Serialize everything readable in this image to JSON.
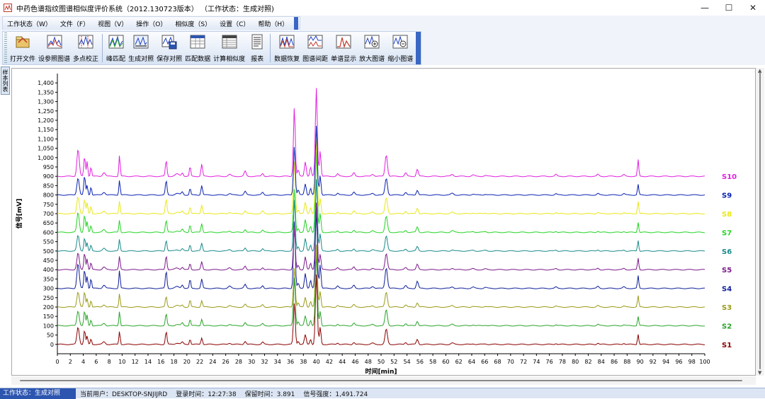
{
  "window": {
    "title": "中药色谱指纹图谱相似度评价系统（2012.130723版本） （工作状态：生成对照)",
    "controls": {
      "minimize": "—",
      "maximize": "☐",
      "close": "✕"
    }
  },
  "menu": [
    {
      "label": "工作状态（W）"
    },
    {
      "label": "文件（F）"
    },
    {
      "label": "视图（V）"
    },
    {
      "label": "操作（O）"
    },
    {
      "label": "相似度（S）"
    },
    {
      "label": "设置（C）"
    },
    {
      "label": "帮助（H）"
    }
  ],
  "toolbar": {
    "group1": [
      {
        "label": "打开文件",
        "icon": "open-file-icon"
      },
      {
        "label": "设参照图谱",
        "icon": "set-reference-icon"
      },
      {
        "label": "多点校正",
        "icon": "multipoint-correction-icon"
      }
    ],
    "group2": [
      {
        "label": "峰匹配",
        "icon": "peak-match-icon"
      },
      {
        "label": "生成对照",
        "icon": "generate-control-icon"
      },
      {
        "label": "保存对照",
        "icon": "save-control-icon"
      },
      {
        "label": "匹配数据",
        "icon": "match-data-icon"
      },
      {
        "label": "计算相似度",
        "icon": "calculate-similarity-icon"
      },
      {
        "label": "报表",
        "icon": "report-icon"
      }
    ],
    "group3": [
      {
        "label": "数据恢复",
        "icon": "data-restore-icon"
      },
      {
        "label": "图谱间距",
        "icon": "spectrum-spacing-icon"
      },
      {
        "label": "单谱显示",
        "icon": "single-spectrum-icon"
      },
      {
        "label": "放大图谱",
        "icon": "zoom-in-icon"
      },
      {
        "label": "缩小图谱",
        "icon": "zoom-out-icon"
      }
    ]
  },
  "dock_tab": {
    "label": "样本列表"
  },
  "chart_data": {
    "type": "line",
    "xlabel": "时间[min]",
    "ylabel": "信号[mV]",
    "xlim": [
      0,
      100
    ],
    "ylim": [
      -50,
      1450
    ],
    "xticks": [
      0,
      2,
      4,
      6,
      8,
      10,
      12,
      14,
      16,
      18,
      20,
      22,
      24,
      26,
      28,
      30,
      32,
      34,
      36,
      38,
      40,
      42,
      44,
      46,
      48,
      50,
      52,
      54,
      56,
      58,
      60,
      62,
      64,
      66,
      68,
      70,
      72,
      74,
      76,
      78,
      80,
      82,
      84,
      86,
      88,
      90,
      92,
      94,
      96,
      98,
      100
    ],
    "yticks": [
      0,
      50,
      100,
      150,
      200,
      250,
      300,
      350,
      400,
      450,
      500,
      550,
      600,
      650,
      700,
      750,
      800,
      850,
      900,
      950,
      1000,
      1050,
      1100,
      1150,
      1200,
      1250,
      1300,
      1350,
      1400
    ],
    "baseline_offset_per_series": 100,
    "peaks": [
      {
        "rt": 3.2,
        "h": 120,
        "w": 0.18
      },
      {
        "rt": 4.2,
        "h": 110,
        "w": 0.12
      },
      {
        "rt": 4.6,
        "h": 70,
        "w": 0.1
      },
      {
        "rt": 5.2,
        "h": 50,
        "w": 0.1
      },
      {
        "rt": 7.2,
        "h": 20,
        "w": 0.2
      },
      {
        "rt": 9.6,
        "h": 95,
        "w": 0.1
      },
      {
        "rt": 16.8,
        "h": 90,
        "w": 0.12
      },
      {
        "rt": 18.5,
        "h": 10,
        "w": 0.3
      },
      {
        "rt": 19.3,
        "h": 18,
        "w": 0.15
      },
      {
        "rt": 20.5,
        "h": 50,
        "w": 0.1
      },
      {
        "rt": 22.3,
        "h": 55,
        "w": 0.12
      },
      {
        "rt": 26.6,
        "h": 10,
        "w": 0.2
      },
      {
        "rt": 29.0,
        "h": 22,
        "w": 0.15
      },
      {
        "rt": 31.7,
        "h": 16,
        "w": 0.15
      },
      {
        "rt": 36.6,
        "h": 330,
        "w": 0.14
      },
      {
        "rt": 37.2,
        "h": 30,
        "w": 0.12
      },
      {
        "rt": 38.3,
        "h": 80,
        "w": 0.14
      },
      {
        "rt": 39.1,
        "h": 40,
        "w": 0.12
      },
      {
        "rt": 40.0,
        "h": 480,
        "w": 0.15
      },
      {
        "rt": 40.6,
        "h": 120,
        "w": 0.12
      },
      {
        "rt": 43.3,
        "h": 12,
        "w": 0.15
      },
      {
        "rt": 45.8,
        "h": 18,
        "w": 0.15
      },
      {
        "rt": 48.7,
        "h": 10,
        "w": 0.2
      },
      {
        "rt": 50.8,
        "h": 120,
        "w": 0.18
      },
      {
        "rt": 53.8,
        "h": 15,
        "w": 0.15
      },
      {
        "rt": 55.6,
        "h": 35,
        "w": 0.15
      },
      {
        "rt": 61.0,
        "h": 10,
        "w": 0.2
      },
      {
        "rt": 64.2,
        "h": 6,
        "w": 0.2
      },
      {
        "rt": 66.1,
        "h": 5,
        "w": 0.2
      },
      {
        "rt": 77.0,
        "h": 8,
        "w": 0.15
      },
      {
        "rt": 83.5,
        "h": 10,
        "w": 0.15
      },
      {
        "rt": 87.5,
        "h": 8,
        "w": 0.15
      },
      {
        "rt": 89.7,
        "h": 75,
        "w": 0.1
      }
    ],
    "series": [
      {
        "name": "S1",
        "color": "#8b0000",
        "baseline": 0,
        "scale": 0.7
      },
      {
        "name": "S2",
        "color": "#2aa32a",
        "baseline": 100,
        "scale": 0.75
      },
      {
        "name": "S3",
        "color": "#9a9a18",
        "baseline": 200,
        "scale": 0.72
      },
      {
        "name": "S4",
        "color": "#0f1f9a",
        "baseline": 300,
        "scale": 1.0
      },
      {
        "name": "S5",
        "color": "#7a1a8a",
        "baseline": 400,
        "scale": 0.8
      },
      {
        "name": "S6",
        "color": "#1a8a8a",
        "baseline": 500,
        "scale": 0.75
      },
      {
        "name": "S7",
        "color": "#23d423",
        "baseline": 600,
        "scale": 0.8
      },
      {
        "name": "S8",
        "color": "#e8e81a",
        "baseline": 700,
        "scale": 0.8
      },
      {
        "name": "S9",
        "color": "#0a22b0",
        "baseline": 800,
        "scale": 0.85
      },
      {
        "name": "S10",
        "color": "#e020e0",
        "baseline": 900,
        "scale": 1.1
      }
    ]
  },
  "status": {
    "state": "工作状态：生成对照",
    "user": "当前用户：DESKTOP-SNJIJRD",
    "login": "登录时间：12:27:38",
    "retention": "保留时间：3.891",
    "signal": "信号强度：1,491.724"
  }
}
